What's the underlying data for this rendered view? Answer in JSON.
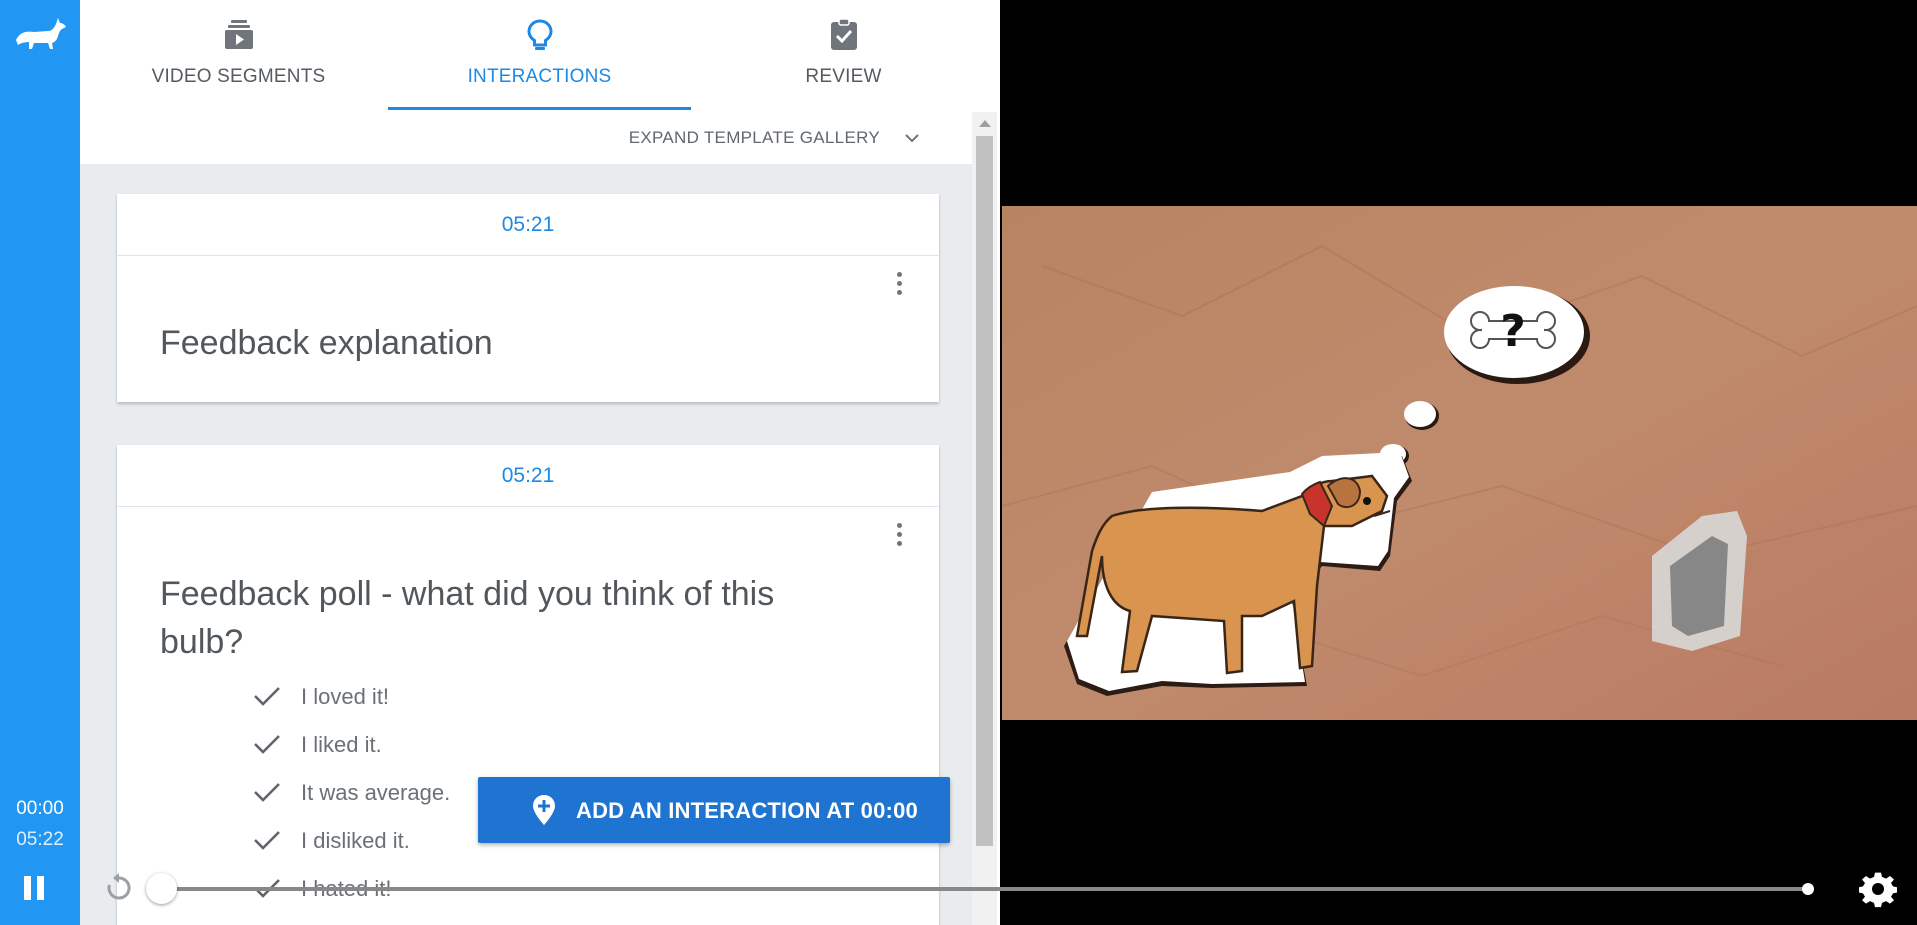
{
  "rail": {
    "current_time": "00:00",
    "duration": "05:22"
  },
  "tabs": [
    {
      "label": "VIDEO SEGMENTS",
      "icon": "video-segments-icon",
      "active": false
    },
    {
      "label": "INTERACTIONS",
      "icon": "lightbulb-icon",
      "active": true
    },
    {
      "label": "REVIEW",
      "icon": "clipboard-check-icon",
      "active": false
    }
  ],
  "gallery": {
    "label": "EXPAND TEMPLATE GALLERY",
    "icon": "chevron-down-icon"
  },
  "cards": [
    {
      "time": "05:21",
      "title": "Feedback explanation"
    },
    {
      "time": "05:21",
      "title": "Feedback poll - what did you think of this bulb?",
      "options": [
        "I loved it!",
        "I liked it.",
        "It was average.",
        "I disliked it.",
        "I hated it!"
      ]
    }
  ],
  "add_button": {
    "label": "ADD AN INTERACTION AT 00:00",
    "icon": "add-location-icon"
  },
  "playback": {
    "progress": 0.0,
    "state": "playing"
  },
  "colors": {
    "rail": "#2196f3",
    "accent": "#1e88e5",
    "button": "#1e74d0",
    "panel_bg": "#e8ecef"
  }
}
